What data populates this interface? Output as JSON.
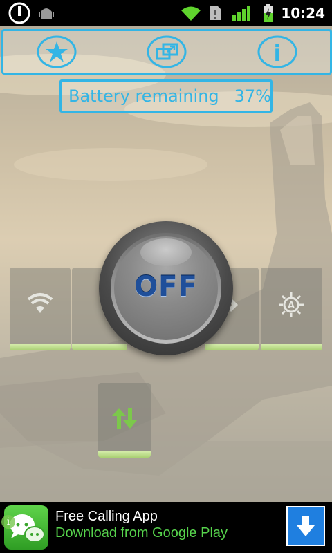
{
  "status_bar": {
    "time": "10:24",
    "icons": [
      "power-icon",
      "android-debug-icon",
      "wifi-icon",
      "sd-card-icon",
      "signal-icon",
      "battery-charging-icon"
    ]
  },
  "toolbar": {
    "buttons": [
      {
        "icon": "star-icon"
      },
      {
        "icon": "external-window-icon"
      },
      {
        "icon": "info-icon",
        "glyph": "i"
      }
    ]
  },
  "battery": {
    "label": "Battery remaining",
    "percent": "37%"
  },
  "toggles": [
    {
      "icon": "wifi-icon"
    },
    {
      "icon": "rotate-icon"
    },
    {
      "icon": "brightness-auto-icon",
      "glyph": "A"
    },
    {
      "icon": "data-sync-icon"
    }
  ],
  "main_button": {
    "label": "OFF"
  },
  "ad": {
    "title": "Free Calling App",
    "subtitle": "Download from Google Play",
    "info_glyph": "i",
    "icon": "chat-bubbles-icon"
  },
  "colors": {
    "accent": "#33b5e5",
    "toggle_bar": "#b7d98a",
    "button_text": "#1f4f9a",
    "ad_subtitle": "#56d24c",
    "ad_download": "#1f7fe0"
  }
}
